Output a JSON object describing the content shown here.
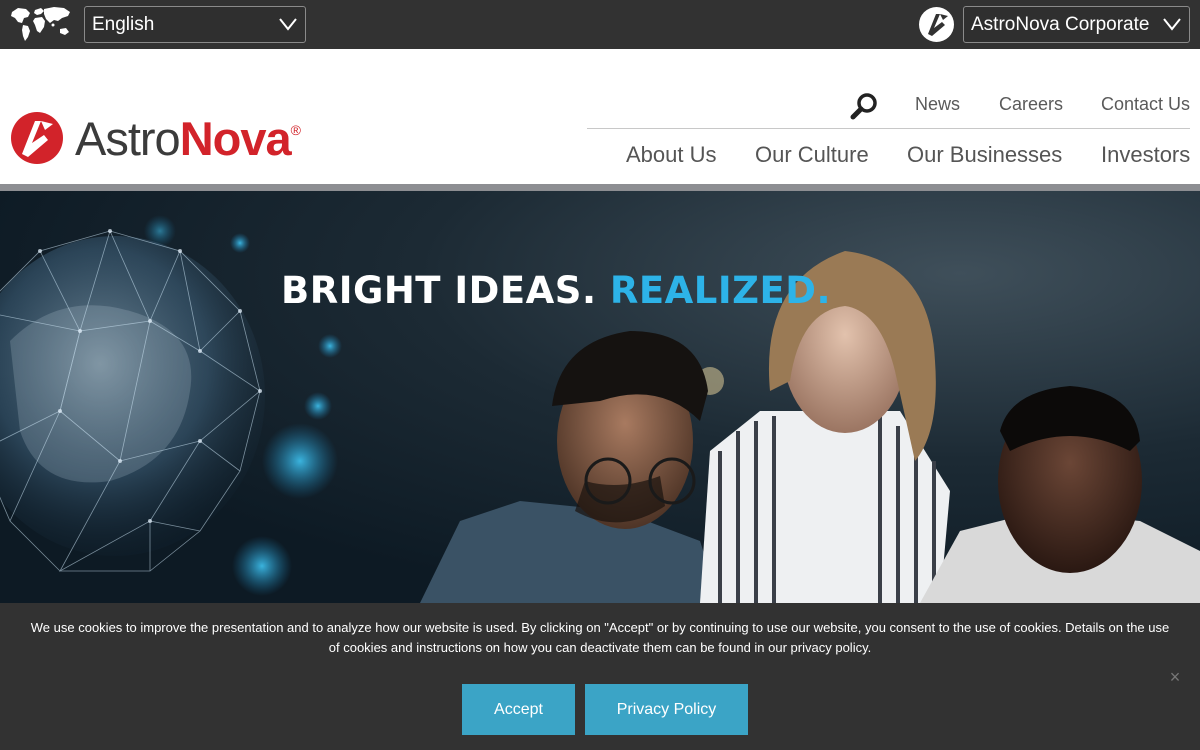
{
  "topbar": {
    "language_selected": "English",
    "site_selected": "AstroNova Corporate"
  },
  "logo": {
    "part1": "Astro",
    "part2": "Nova",
    "registered": "®"
  },
  "utility_nav": [
    {
      "label": "News"
    },
    {
      "label": "Careers"
    },
    {
      "label": "Contact Us"
    }
  ],
  "main_nav": [
    {
      "label": "About Us"
    },
    {
      "label": "Our Culture"
    },
    {
      "label": "Our Businesses"
    },
    {
      "label": "Investors"
    }
  ],
  "hero": {
    "headline_part1": "BRIGHT IDEAS.",
    "headline_part2": "REALIZED."
  },
  "cookie": {
    "text": "We use cookies to improve the presentation and to analyze how our website is used. By clicking on \"Accept\" or by continuing to use our website, you consent to the use of cookies. Details on the use of cookies and instructions on how you can deactivate them can be found in our privacy policy.",
    "accept_label": "Accept",
    "privacy_label": "Privacy Policy",
    "close_label": "×"
  },
  "colors": {
    "topbar_bg": "#323232",
    "brand_red": "#d2232a",
    "accent_blue": "#2db3e8",
    "button_blue": "#3ba4c6"
  },
  "icons": [
    "world-map-icon",
    "chevron-down-icon",
    "astronova-mark-icon",
    "search-icon",
    "close-icon"
  ]
}
